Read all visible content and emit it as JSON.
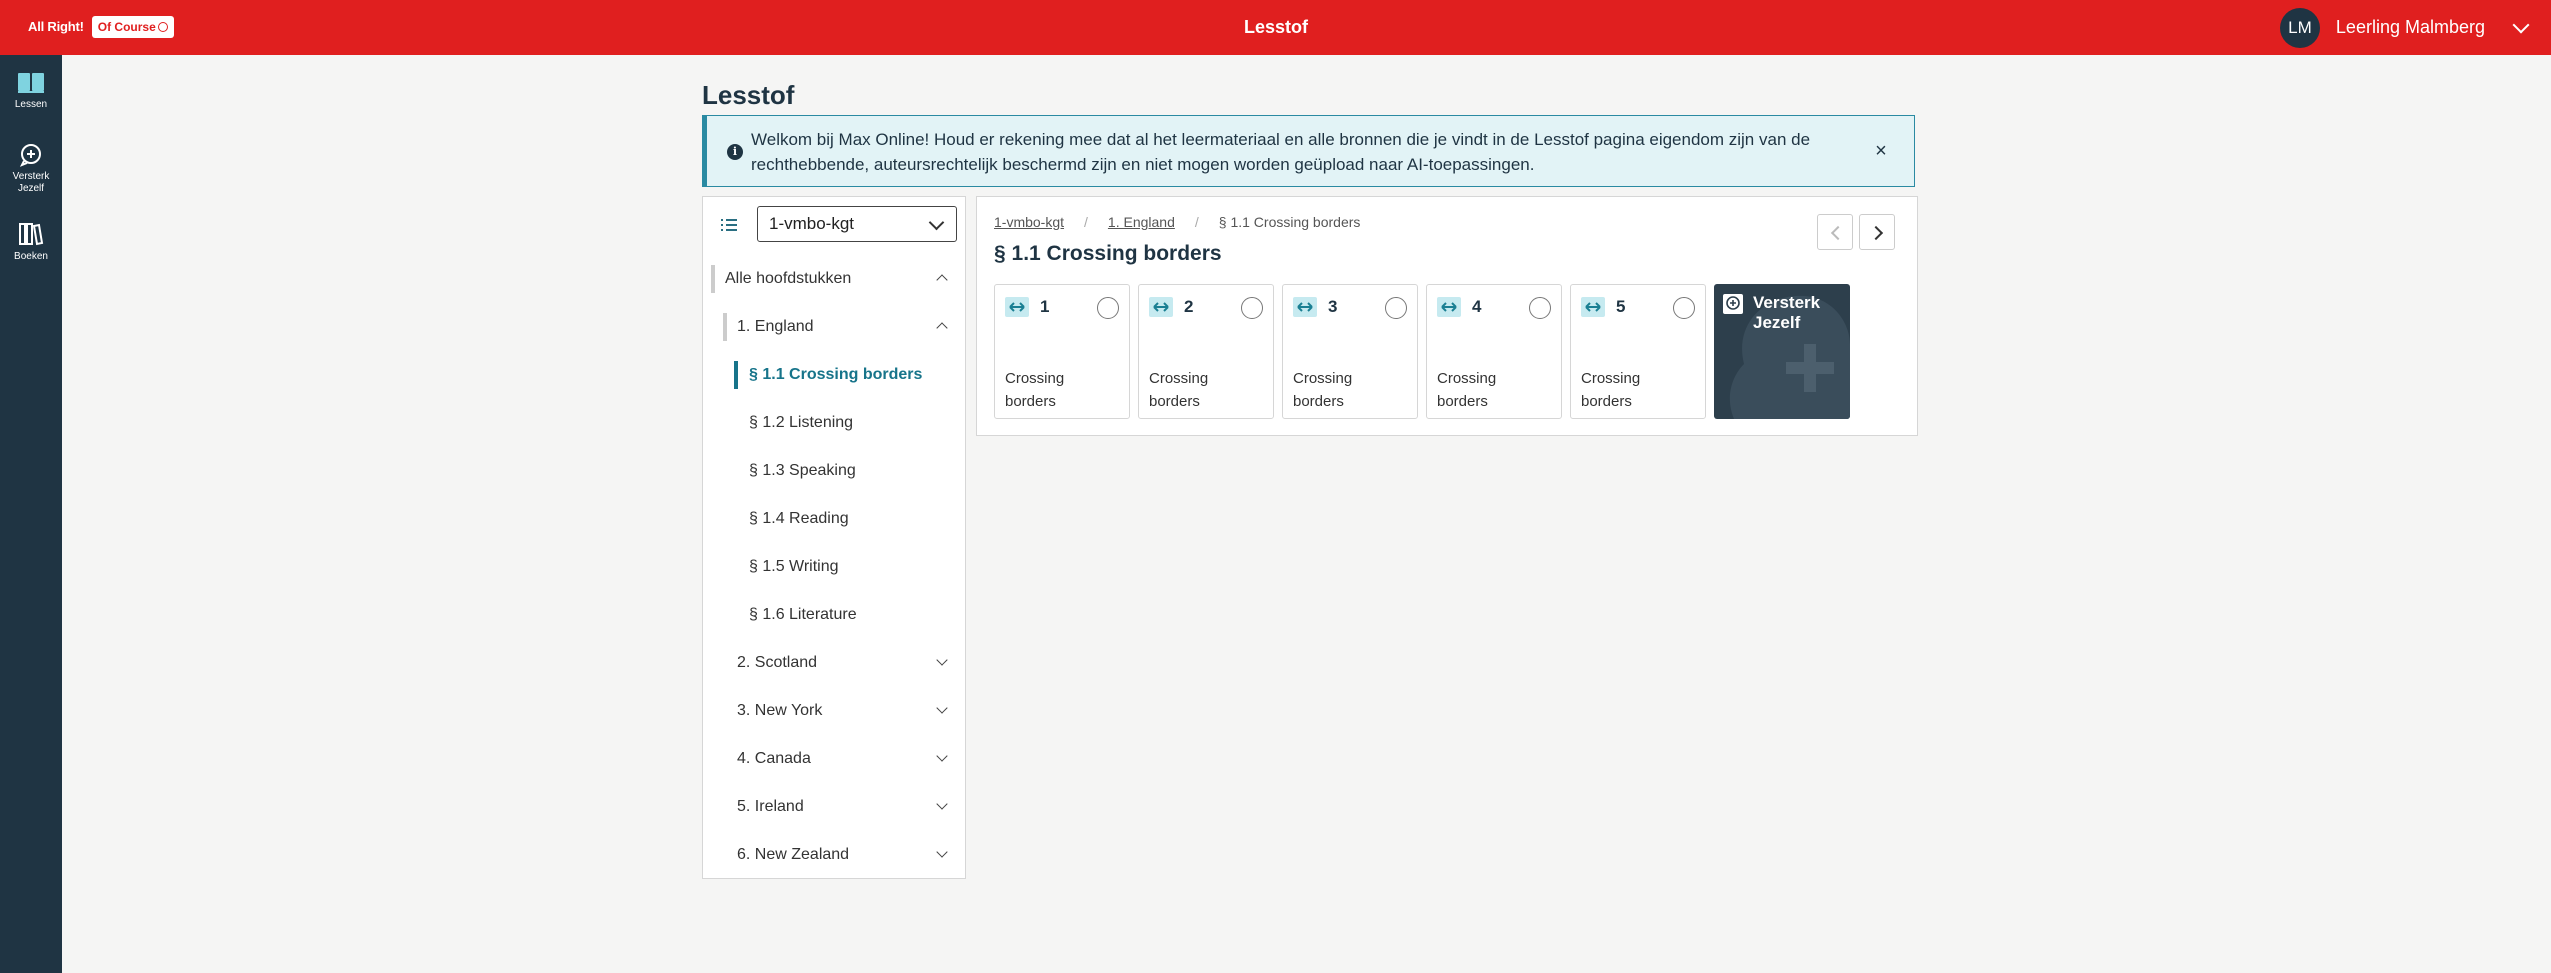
{
  "header": {
    "logo_part1": "All Right!",
    "logo_part2": "Of Course",
    "app_title": "Lesstof",
    "user_initials": "LM",
    "user_name": "Leerling Malmberg",
    "brand_color": "#e01f1f"
  },
  "rail": {
    "items": [
      {
        "label": "Lessen",
        "icon": "book-open-icon",
        "active": true
      },
      {
        "label": "Versterk Jezelf",
        "icon": "plus-bubble-icon",
        "active": false
      },
      {
        "label": "Boeken",
        "icon": "books-icon",
        "active": false
      }
    ],
    "color": "#1f3443"
  },
  "page": {
    "title": "Lesstof"
  },
  "banner": {
    "text": "Welkom bij Max Online! Houd er rekening mee dat al het leermateriaal en alle bronnen die je vindt in de Lesstof pagina eigendom zijn van de rechthebbende, auteursrechtelijk beschermd zijn en niet mogen worden geüpload naar AI-toepassingen.",
    "info_icon": "info-icon",
    "close_icon": "close-icon",
    "close_label": "×",
    "info_label": "i"
  },
  "sidebar": {
    "method_select": "1-vmbo-kgt",
    "all_chapters": "Alle hoofdstukken",
    "chapters": [
      {
        "label": "1. England",
        "expanded": true
      },
      {
        "label": "2. Scotland",
        "expanded": false
      },
      {
        "label": "3. New York",
        "expanded": false
      },
      {
        "label": "4. Canada",
        "expanded": false
      },
      {
        "label": "5. Ireland",
        "expanded": false
      },
      {
        "label": "6. New Zealand",
        "expanded": false
      }
    ],
    "sections": [
      {
        "label": "§ 1.1 Crossing borders",
        "active": true
      },
      {
        "label": "§ 1.2 Listening",
        "active": false
      },
      {
        "label": "§ 1.3 Speaking",
        "active": false
      },
      {
        "label": "§ 1.4 Reading",
        "active": false
      },
      {
        "label": "§ 1.5 Writing",
        "active": false
      },
      {
        "label": "§ 1.6 Literature",
        "active": false
      }
    ],
    "accent_color": "#17748a"
  },
  "content": {
    "breadcrumb": [
      "1-vmbo-kgt",
      "1. England",
      "§ 1.1 Crossing borders"
    ],
    "breadcrumb_sep": "/",
    "section_title": "§ 1.1 Crossing borders",
    "cards": [
      {
        "number": "1",
        "text": "Crossing borders"
      },
      {
        "number": "2",
        "text": "Crossing borders"
      },
      {
        "number": "3",
        "text": "Crossing borders"
      },
      {
        "number": "4",
        "text": "Crossing borders"
      },
      {
        "number": "5",
        "text": "Crossing borders"
      }
    ],
    "versterk_card": "Versterk Jezelf",
    "card_tag_color": "#c6eaf0",
    "versterk_color": "#2d3f4c"
  }
}
